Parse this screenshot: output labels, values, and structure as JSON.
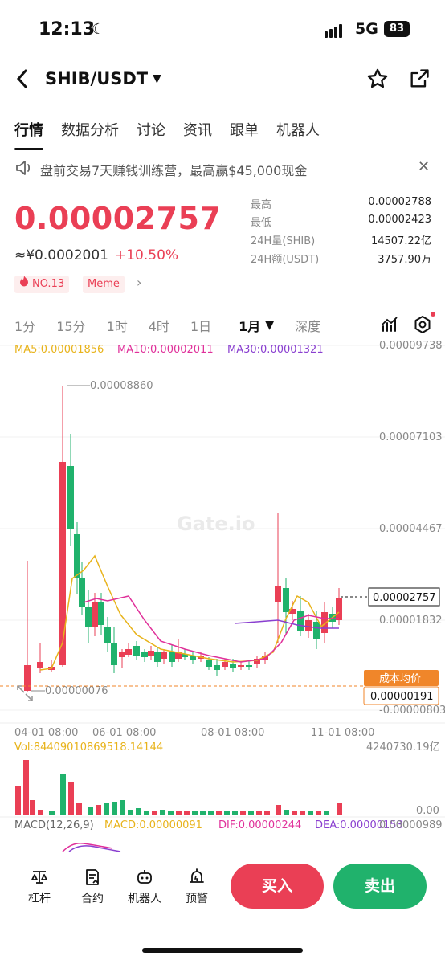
{
  "status": {
    "time": "12:13",
    "network": "5G",
    "battery": "83"
  },
  "header": {
    "pair": "SHIB/USDT"
  },
  "tabs": [
    "行情",
    "数据分析",
    "讨论",
    "资讯",
    "跟单",
    "机器人"
  ],
  "banner": {
    "text": "盘前交易7天赚钱训练营，最高赢$45,000现金"
  },
  "price": {
    "last": "0.00002757",
    "cny": "≈¥0.0002001",
    "change": "+10.50%",
    "rank": "NO.13",
    "tag": "Meme"
  },
  "stats": [
    {
      "label": "最高",
      "value": "0.00002788"
    },
    {
      "label": "最低",
      "value": "0.00002423"
    },
    {
      "label": "24H量(SHIB)",
      "value": "14507.22亿"
    },
    {
      "label": "24H额(USDT)",
      "value": "3757.90万"
    }
  ],
  "intervals": [
    "1分",
    "15分",
    "1时",
    "4时",
    "1日",
    "1月",
    "深度"
  ],
  "chart": {
    "ma": [
      "MA5:0.00001856",
      "MA10:0.00002011",
      "MA30:0.00001321"
    ],
    "y_ticks": [
      "0.00009738",
      "0.00007103",
      "0.00004467",
      "0.00001832",
      "-0.00000803"
    ],
    "high_label": "0.00008860",
    "low_label": "0.00000076",
    "last_label": "0.00002757",
    "cost_label": "成本均价",
    "cost_value": "0.00000191",
    "watermark": "Gate.io",
    "x_ticks": [
      "04-01 08:00",
      "06-01 08:00",
      "08-01 08:00",
      "11-01 08:00"
    ],
    "vol_label": "Vol:84409010869518.14144",
    "vol_max": "4240730.19亿",
    "vol_zero": "0.00",
    "macd_label": "MACD(12,26,9)",
    "macd_val": "MACD:0.00000091",
    "dif_val": "DIF:0.00000244",
    "dea_val": "DEA:0.00000153",
    "macd_axis": "0.00000989"
  },
  "bottom": {
    "items": [
      "杠杆",
      "合约",
      "机器人",
      "预警"
    ],
    "buy": "买入",
    "sell": "卖出"
  },
  "colors": {
    "up": "#ea3f55",
    "down": "#20b26c",
    "ma5": "#e8b31b",
    "ma10": "#e0309a",
    "ma30": "#8a3fd0",
    "cost": "#f0862a"
  }
}
